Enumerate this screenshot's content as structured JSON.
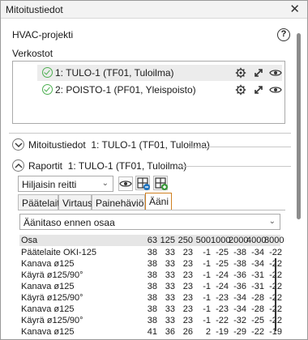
{
  "window": {
    "title": "Mitoitustiedot",
    "close_glyph": "✕"
  },
  "project": {
    "title": "HVAC-projekti",
    "help_glyph": "?"
  },
  "networks": {
    "label": "Verkostot",
    "items": [
      {
        "label": "1: TULO-1 (TF01, Tuloilma)",
        "status": "ok",
        "selected": true
      },
      {
        "label": "2: POISTO-1 (PF01, Yleispoisto)",
        "status": "ok",
        "selected": false
      }
    ],
    "row_icons": [
      "gear-icon",
      "expand-icon",
      "eye-icon"
    ]
  },
  "sizing": {
    "label": "Mitoitustiedot",
    "network": "1: TULO-1 (TF01, Tuloilma)",
    "expanded": false
  },
  "reports": {
    "label": "Raportit",
    "network": "1: TULO-1 (TF01, Tuloilma)",
    "expanded": true,
    "route_select": "Hiljaisin reitti",
    "tabs": [
      "Päätelaite",
      "Virtaus",
      "Painehäviö",
      "Ääni"
    ],
    "active_tab": "Ääni",
    "level_select": "Äänitaso ennen osaa"
  },
  "sound_table": {
    "header": {
      "name": "Osa",
      "vals": [
        "63",
        "125",
        "250",
        "500",
        "1000",
        "2000",
        "4000",
        "8000"
      ]
    },
    "rows": [
      {
        "name": "Päätelaite OKI-125",
        "vals": [
          "38",
          "33",
          "23",
          "-1",
          "-25",
          "-38",
          "-34",
          "-22"
        ]
      },
      {
        "name": "Kanava ø125",
        "vals": [
          "38",
          "33",
          "23",
          "-1",
          "-25",
          "-38",
          "-34",
          "-22"
        ]
      },
      {
        "name": "Käyrä ø125/90°",
        "vals": [
          "38",
          "33",
          "23",
          "-1",
          "-24",
          "-36",
          "-31",
          "-22"
        ]
      },
      {
        "name": "Kanava ø125",
        "vals": [
          "38",
          "33",
          "23",
          "-1",
          "-24",
          "-36",
          "-31",
          "-22"
        ]
      },
      {
        "name": "Käyrä ø125/90°",
        "vals": [
          "38",
          "33",
          "23",
          "-1",
          "-23",
          "-34",
          "-28",
          "-22"
        ]
      },
      {
        "name": "Kanava ø125",
        "vals": [
          "38",
          "33",
          "23",
          "-1",
          "-23",
          "-34",
          "-28",
          "-22"
        ]
      },
      {
        "name": "Käyrä ø125/90°",
        "vals": [
          "38",
          "33",
          "23",
          "-1",
          "-22",
          "-32",
          "-25",
          "-22"
        ]
      },
      {
        "name": "Kanava ø125",
        "vals": [
          "41",
          "36",
          "26",
          "2",
          "-19",
          "-29",
          "-22",
          "-19"
        ]
      }
    ]
  },
  "colors": {
    "check": "#4caf50",
    "active_tab_border": "#d08020",
    "selected_row": "#ececec"
  }
}
